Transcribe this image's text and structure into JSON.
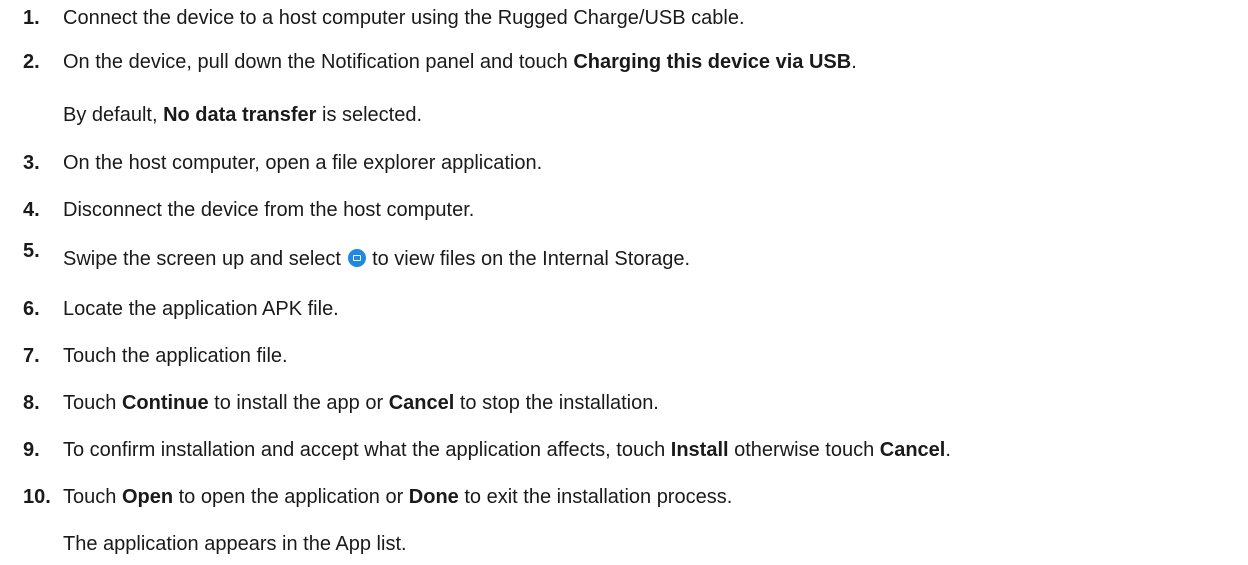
{
  "steps": [
    {
      "number": "1.",
      "text": "Connect the device to a host computer using the Rugged Charge/USB cable."
    },
    {
      "number": "2.",
      "text_before": "On the device, pull down the Notification panel and touch ",
      "bold": "Charging this device via USB",
      "text_after": ".",
      "note_before": "By default, ",
      "note_bold": "No data transfer",
      "note_after": " is selected."
    },
    {
      "number": "3.",
      "text": "On the host computer, open a file explorer application."
    },
    {
      "number": "4.",
      "text": "Disconnect the device from the host computer."
    },
    {
      "number": "5.",
      "text_before": "Swipe the screen up and select ",
      "icon": "files-app-icon",
      "text_after": " to view files on the Internal Storage."
    },
    {
      "number": "6.",
      "text": "Locate the application APK file."
    },
    {
      "number": "7.",
      "text": "Touch the application file."
    },
    {
      "number": "8.",
      "text_before": "Touch ",
      "bold1": "Continue",
      "text_middle": " to install the app or ",
      "bold2": "Cancel",
      "text_after": " to stop the installation."
    },
    {
      "number": "9.",
      "text_before": "To confirm installation and accept what the application affects, touch ",
      "bold1": "Install",
      "text_middle": " otherwise touch ",
      "bold2": "Cancel",
      "text_after": "."
    },
    {
      "number": "10.",
      "text_before": "Touch ",
      "bold1": "Open",
      "text_middle": " to open the application or ",
      "bold2": "Done",
      "text_after": " to exit the installation process.",
      "note": "The application appears in the App list."
    }
  ],
  "colors": {
    "text": "#1a1a1a",
    "icon": "#1e88e5"
  }
}
